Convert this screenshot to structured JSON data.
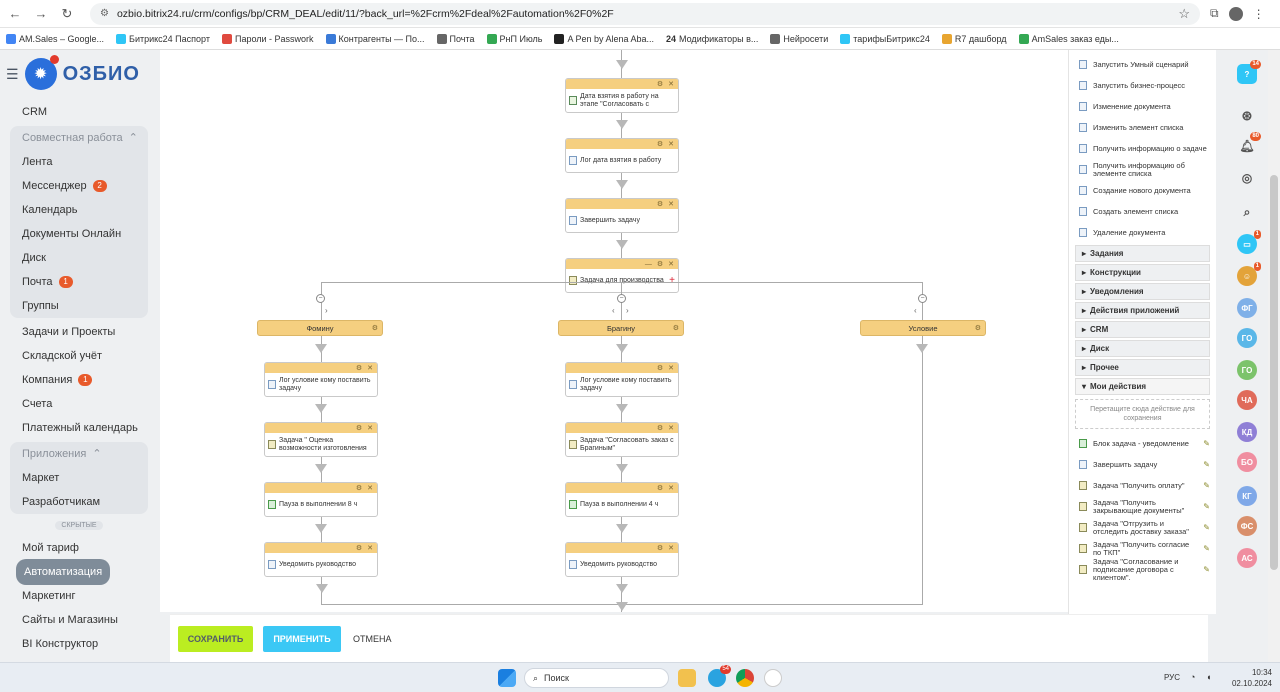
{
  "browser": {
    "url": "ozbio.bitrix24.ru/crm/configs/bp/CRM_DEAL/edit/11/?back_url=%2Fcrm%2Fdeal%2Fautomation%2F0%2F",
    "bookmarks": [
      "AM.Sales – Google...",
      "Битрикс24 Паспорт",
      "Пароли - Passwork",
      "Контрагенты — По...",
      "Почта",
      "РнП Июль",
      "A Pen by Alena Aba...",
      "Модификаторы в...",
      "Нейросети",
      "тарифыБитрикс24",
      "R7 дашборд",
      "AmSales заказ еды..."
    ],
    "bookmark_24": "24"
  },
  "logo": {
    "text": "ОЗБИО"
  },
  "sidebar": {
    "crm": "CRM",
    "group_work": "Совместная работа",
    "work_items": [
      {
        "label": "Лента",
        "badge": ""
      },
      {
        "label": "Мессенджер",
        "badge": "2"
      },
      {
        "label": "Календарь",
        "badge": ""
      },
      {
        "label": "Документы Онлайн",
        "badge": ""
      },
      {
        "label": "Диск",
        "badge": ""
      },
      {
        "label": "Почта",
        "badge": "1"
      },
      {
        "label": "Группы",
        "badge": ""
      }
    ],
    "tasks": "Задачи и Проекты",
    "warehouse": "Складской учёт",
    "company": "Компания",
    "company_badge": "1",
    "invoices": "Счета",
    "payment_calendar": "Платежный календарь",
    "group_apps": "Приложения",
    "market": "Маркет",
    "developers": "Разработчикам",
    "hidden": "СКРЫТЫЕ",
    "my_tariff": "Мой тариф",
    "automation": "Автоматизация",
    "marketing": "Маркетинг",
    "sites": "Сайты и Магазины",
    "bi": "BI Конструктор"
  },
  "workflow": {
    "top_blocks": [
      {
        "text": "Дата взятия в работу на этапе \"Согласовать с"
      },
      {
        "text": "Лог дата взятия в работу"
      },
      {
        "text": "Завершить задачу"
      }
    ],
    "parallel": "Задача для производства",
    "branches": [
      "Фомину",
      "Брагину",
      "Условие"
    ],
    "left_blocks": [
      {
        "text": "Лог условие кому поставить задачу"
      },
      {
        "text": "Задача \" Оценка возможности изготовления"
      },
      {
        "text": "Пауза в выполнении 8 ч"
      },
      {
        "text": "Уведомить руководство"
      }
    ],
    "mid_blocks": [
      {
        "text": "Лог условие кому поставить задачу"
      },
      {
        "text": "Задача \"Согласовать заказ с Брагиным\""
      },
      {
        "text": "Пауза в выполнении 4 ч"
      },
      {
        "text": "Уведомить руководство"
      }
    ]
  },
  "footer": {
    "save": "СОХРАНИТЬ",
    "apply": "ПРИМЕНИТЬ",
    "cancel": "ОТМЕНА"
  },
  "panel": {
    "items": [
      "Запустить Умный сценарий",
      "Запустить бизнес-процесс",
      "Изменение документа",
      "Изменить элемент списка",
      "Получить информацию о задаче",
      "Получить информацию об элементе списка",
      "Создание нового документа",
      "Создать элемент списка",
      "Удаление документа"
    ],
    "categories": [
      "Задания",
      "Конструкции",
      "Уведомления",
      "Действия приложений",
      "CRM",
      "Диск",
      "Прочее"
    ],
    "my_actions": "Мои действия",
    "drop_hint": "Перетащите сюда действие для сохранения",
    "my_items": [
      "Блок задача - уведомление",
      "Завершить задачу",
      "Задача \"Получить оплату\"",
      "Задача \"Получить закрывающие документы\"",
      "Задача \"Отгрузить и отследить доставку заказа\"",
      "Задача \"Получить согласие по ТКП\"",
      "Задача \"Согласование и подписание договора с клиентом\"."
    ]
  },
  "rightbar": {
    "help_badge": "14",
    "bell_badge": "80",
    "chat_badge": "1",
    "avatar_badge": "1",
    "avatars": [
      "ФГ",
      "ГО",
      "ГО",
      "ЧА",
      "КД",
      "БО",
      "КГ",
      "ФС",
      "АС"
    ]
  },
  "taskbar": {
    "search": "Поиск",
    "lang": "РУС",
    "time": "10:34",
    "date": "02.10.2024",
    "telegram_badge": "54"
  }
}
